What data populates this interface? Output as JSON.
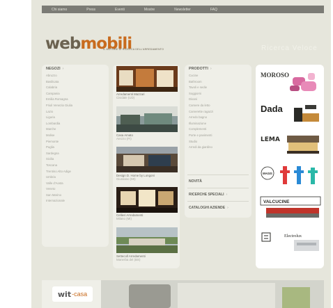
{
  "topnav": [
    "Chi siamo",
    "Press",
    "Eventi",
    "Mostre",
    "Newsletter",
    "FAQ"
  ],
  "header": {
    "logo_part1": "web",
    "logo_part2": "mobili",
    "tagline": "IL MOTORE DI RICERCA DELL'ARREDAMENTO",
    "search_hint": "Ricerca Veloce"
  },
  "negozi": {
    "title": "NEGOZI",
    "items": [
      "Abruzzo",
      "Basilicata",
      "Calabria",
      "Campania",
      "Emilia Romagna",
      "Friuli Venezia Giulia",
      "Lazio",
      "Liguria",
      "Lombardia",
      "Marche",
      "Molise",
      "Piemonte",
      "Puglia",
      "Sardegna",
      "Sicilia",
      "Toscana",
      "Trentino Alto Adige",
      "Umbria",
      "Valle d'Aosta",
      "Veneto",
      "San Marino",
      "Internazionale"
    ]
  },
  "showrooms": [
    {
      "title": "Arredamenti Mazzari",
      "city": "Cividale (UD)"
    },
    {
      "title": "Casa Amato",
      "city": "Arezzo (FI)"
    },
    {
      "title": "Design D. Home by Longoni",
      "city": "Giussano (MI)"
    },
    {
      "title": "Cellieri Arredamenti",
      "city": "Milano (MI)"
    },
    {
      "title": "Settecoll Arredamenti",
      "city": "Manerba del (BS)"
    }
  ],
  "prodotti": {
    "title": "PRODOTTI",
    "items": [
      "Cucine",
      "Bathroom",
      "Tavoli e sedie",
      "Soggiorni",
      "Divani",
      "Camere da letto",
      "Camerette ragazzi",
      "Arredo bagno",
      "Illuminazione",
      "Complementi",
      "Porte e pavimenti",
      "Studio",
      "Arredi da giardino"
    ],
    "links": [
      {
        "label": "NOVITÀ",
        "arrow": ""
      },
      {
        "label": "RICERCHE SPECIALI",
        "arrow": "›"
      },
      {
        "label": "CATALOGHI AZIENDE",
        "arrow": "›"
      }
    ]
  },
  "brands": [
    "MOROSO",
    "Dada",
    "LEMA",
    "MAGIS",
    "VALCUCINE",
    "Electrolux"
  ],
  "banner": {
    "brand_part1": "wit",
    "brand_part2": "-casa"
  },
  "colors": {
    "accent_orange": "#c86b1e",
    "logo_brown": "#6b6250",
    "nav_bg": "#7b7b75",
    "page_bg": "#e6e6dc"
  }
}
